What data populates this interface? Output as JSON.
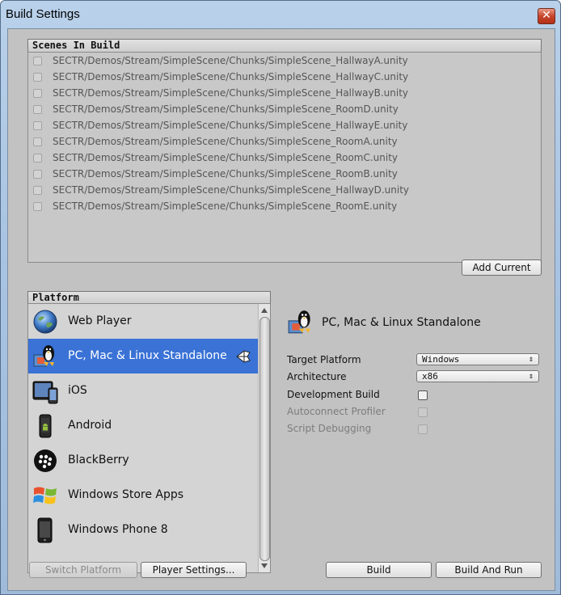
{
  "window": {
    "title": "Build Settings"
  },
  "scenes": {
    "header": "Scenes In Build",
    "items": [
      "SECTR/Demos/Stream/SimpleScene/Chunks/SimpleScene_HallwayA.unity",
      "SECTR/Demos/Stream/SimpleScene/Chunks/SimpleScene_HallwayC.unity",
      "SECTR/Demos/Stream/SimpleScene/Chunks/SimpleScene_HallwayB.unity",
      "SECTR/Demos/Stream/SimpleScene/Chunks/SimpleScene_RoomD.unity",
      "SECTR/Demos/Stream/SimpleScene/Chunks/SimpleScene_HallwayE.unity",
      "SECTR/Demos/Stream/SimpleScene/Chunks/SimpleScene_RoomA.unity",
      "SECTR/Demos/Stream/SimpleScene/Chunks/SimpleScene_RoomC.unity",
      "SECTR/Demos/Stream/SimpleScene/Chunks/SimpleScene_RoomB.unity",
      "SECTR/Demos/Stream/SimpleScene/Chunks/SimpleScene_HallwayD.unity",
      "SECTR/Demos/Stream/SimpleScene/Chunks/SimpleScene_RoomE.unity"
    ],
    "add_current_label": "Add Current"
  },
  "platform": {
    "header": "Platform",
    "items": [
      {
        "label": "Web Player",
        "icon": "globe-icon"
      },
      {
        "label": "PC, Mac & Linux Standalone",
        "icon": "pc-mac-linux-icon",
        "selected": true
      },
      {
        "label": "iOS",
        "icon": "ios-device-icon"
      },
      {
        "label": "Android",
        "icon": "android-phone-icon"
      },
      {
        "label": "BlackBerry",
        "icon": "blackberry-icon"
      },
      {
        "label": "Windows Store Apps",
        "icon": "windows-logo-icon"
      },
      {
        "label": "Windows Phone 8",
        "icon": "windows-phone-icon"
      }
    ]
  },
  "settings": {
    "title": "PC, Mac & Linux Standalone",
    "target_platform_label": "Target Platform",
    "target_platform_value": "Windows",
    "architecture_label": "Architecture",
    "architecture_value": "x86",
    "development_build_label": "Development Build",
    "autoconnect_profiler_label": "Autoconnect Profiler",
    "script_debugging_label": "Script Debugging"
  },
  "buttons": {
    "switch_platform": "Switch Platform",
    "player_settings": "Player Settings...",
    "build": "Build",
    "build_and_run": "Build And Run"
  },
  "colors": {
    "selection": "#3a72d6",
    "panel_bg": "#c2c2c2",
    "title_bar": "#b9d1ea"
  }
}
